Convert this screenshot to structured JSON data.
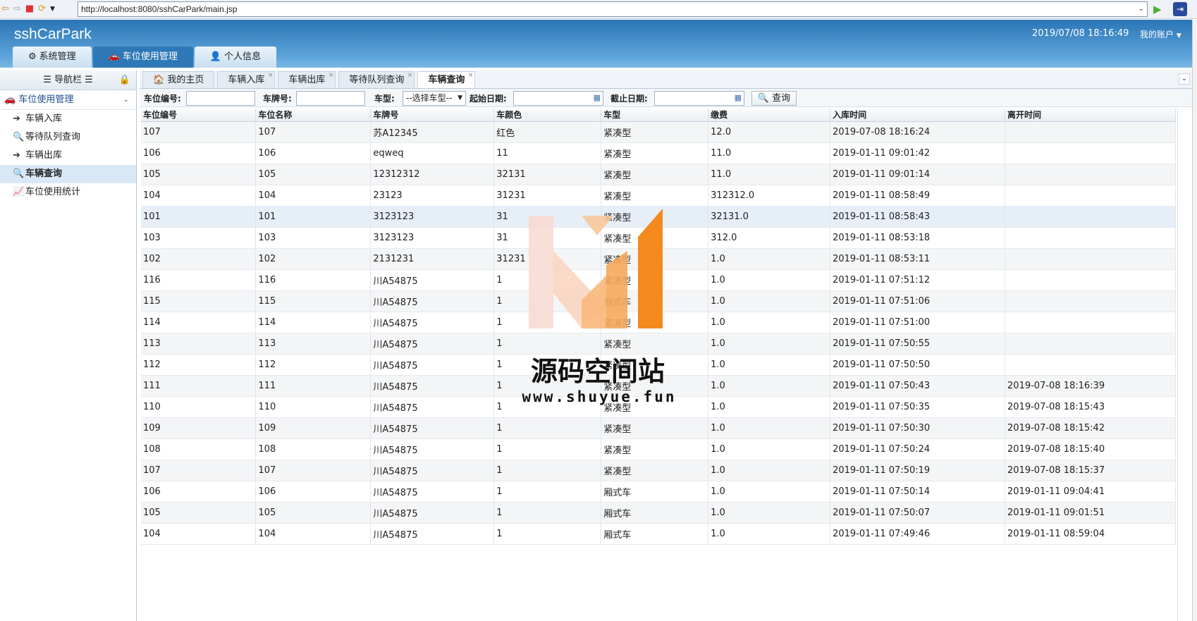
{
  "browser": {
    "url": "http://localhost:8080/sshCarPark/main.jsp"
  },
  "header": {
    "title": "sshCarPark",
    "datetime": "2019/07/08 18:16:49",
    "account": "我的账户"
  },
  "top_tabs": [
    {
      "label": "系统管理",
      "icon": "gear-icon"
    },
    {
      "label": "车位使用管理",
      "icon": "car-icon"
    },
    {
      "label": "个人信息",
      "icon": "user-icon"
    }
  ],
  "sidebar": {
    "title": "导航栏",
    "group": "车位使用管理",
    "items": [
      {
        "label": "车辆入库",
        "icon": "arrow-circle-icon"
      },
      {
        "label": "等待队列查询",
        "icon": "search-icon"
      },
      {
        "label": "车辆出库",
        "icon": "arrow-circle-icon"
      },
      {
        "label": "车辆查询",
        "icon": "search-icon"
      },
      {
        "label": "车位使用统计",
        "icon": "line-chart-icon"
      }
    ]
  },
  "content_tabs": [
    {
      "label": "我的主页"
    },
    {
      "label": "车辆入库"
    },
    {
      "label": "车辆出库"
    },
    {
      "label": "等待队列查询"
    },
    {
      "label": "车辆查询"
    }
  ],
  "search": {
    "space_no_label": "车位编号:",
    "plate_label": "车牌号:",
    "type_label": "车型:",
    "type_placeholder": "--选择车型--",
    "start_label": "起始日期:",
    "end_label": "截止日期:",
    "button": "查询"
  },
  "table": {
    "columns": [
      "车位编号",
      "车位名称",
      "车牌号",
      "车颜色",
      "车型",
      "缴费",
      "入库时间",
      "离开时间"
    ],
    "rows": [
      [
        "107",
        "107",
        "苏A12345",
        "红色",
        "紧凑型",
        "12.0",
        "2019-07-08 18:16:24",
        ""
      ],
      [
        "106",
        "106",
        "eqweq",
        "11",
        "紧凑型",
        "11.0",
        "2019-01-11 09:01:42",
        ""
      ],
      [
        "105",
        "105",
        "12312312",
        "32131",
        "紧凑型",
        "11.0",
        "2019-01-11 09:01:14",
        ""
      ],
      [
        "104",
        "104",
        "23123",
        "31231",
        "紧凑型",
        "312312.0",
        "2019-01-11 08:58:49",
        ""
      ],
      [
        "101",
        "101",
        "3123123",
        "31",
        "紧凑型",
        "32131.0",
        "2019-01-11 08:58:43",
        ""
      ],
      [
        "103",
        "103",
        "3123123",
        "31",
        "紧凑型",
        "312.0",
        "2019-01-11 08:53:18",
        ""
      ],
      [
        "102",
        "102",
        "2131231",
        "31231",
        "紧凑型",
        "1.0",
        "2019-01-11 08:53:11",
        ""
      ],
      [
        "116",
        "116",
        "川A54875",
        "1",
        "紧凑型",
        "1.0",
        "2019-01-11 07:51:12",
        ""
      ],
      [
        "115",
        "115",
        "川A54875",
        "1",
        "厢式车",
        "1.0",
        "2019-01-11 07:51:06",
        ""
      ],
      [
        "114",
        "114",
        "川A54875",
        "1",
        "紧凑型",
        "1.0",
        "2019-01-11 07:51:00",
        ""
      ],
      [
        "113",
        "113",
        "川A54875",
        "1",
        "紧凑型",
        "1.0",
        "2019-01-11 07:50:55",
        ""
      ],
      [
        "112",
        "112",
        "川A54875",
        "1",
        "紧凑型",
        "1.0",
        "2019-01-11 07:50:50",
        ""
      ],
      [
        "111",
        "111",
        "川A54875",
        "1",
        "紧凑型",
        "1.0",
        "2019-01-11 07:50:43",
        "2019-07-08 18:16:39"
      ],
      [
        "110",
        "110",
        "川A54875",
        "1",
        "紧凑型",
        "1.0",
        "2019-01-11 07:50:35",
        "2019-07-08 18:15:43"
      ],
      [
        "109",
        "109",
        "川A54875",
        "1",
        "紧凑型",
        "1.0",
        "2019-01-11 07:50:30",
        "2019-07-08 18:15:42"
      ],
      [
        "108",
        "108",
        "川A54875",
        "1",
        "紧凑型",
        "1.0",
        "2019-01-11 07:50:24",
        "2019-07-08 18:15:40"
      ],
      [
        "107",
        "107",
        "川A54875",
        "1",
        "紧凑型",
        "1.0",
        "2019-01-11 07:50:19",
        "2019-07-08 18:15:37"
      ],
      [
        "106",
        "106",
        "川A54875",
        "1",
        "厢式车",
        "1.0",
        "2019-01-11 07:50:14",
        "2019-01-11 09:04:41"
      ],
      [
        "105",
        "105",
        "川A54875",
        "1",
        "厢式车",
        "1.0",
        "2019-01-11 07:50:07",
        "2019-01-11 09:01:51"
      ],
      [
        "104",
        "104",
        "川A54875",
        "1",
        "厢式车",
        "1.0",
        "2019-01-11 07:49:46",
        "2019-01-11 08:59:04"
      ]
    ]
  },
  "watermark": {
    "title": "源码空间站",
    "url": "www.shuyue.fun"
  },
  "colors": {
    "header": "#2a75b6",
    "active_tab": "#2e78b7",
    "watermark_orange": "#f48a1e"
  }
}
